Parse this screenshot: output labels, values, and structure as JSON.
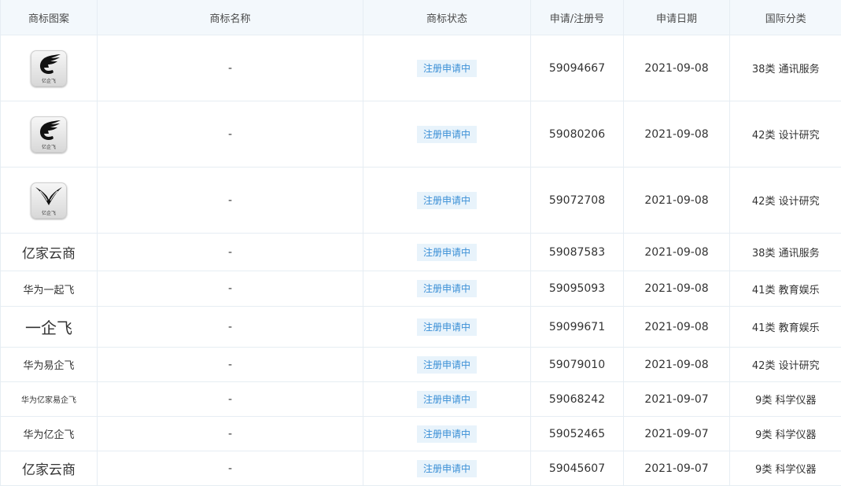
{
  "headers": {
    "image": "商标图案",
    "name": "商标名称",
    "status": "商标状态",
    "reg_no": "申请/注册号",
    "date": "申请日期",
    "class": "国际分类"
  },
  "rows": [
    {
      "mark_type": "image",
      "icon": "wing-g-logo-icon",
      "mark_caption": "亿企飞",
      "name": "-",
      "status": "注册申请中",
      "reg_no": "59094667",
      "date": "2021-09-08",
      "class": "38类 通讯服务"
    },
    {
      "mark_type": "image",
      "icon": "wing-g-logo-icon",
      "mark_caption": "亿企飞",
      "name": "-",
      "status": "注册申请中",
      "reg_no": "59080206",
      "date": "2021-09-08",
      "class": "42类 设计研究"
    },
    {
      "mark_type": "image",
      "icon": "wings-logo-icon",
      "mark_caption": "亿企飞",
      "name": "-",
      "status": "注册申请中",
      "reg_no": "59072708",
      "date": "2021-09-08",
      "class": "42类 设计研究"
    },
    {
      "mark_type": "text",
      "mark_text": "亿家云商",
      "name": "-",
      "status": "注册申请中",
      "reg_no": "59087583",
      "date": "2021-09-08",
      "class": "38类 通讯服务"
    },
    {
      "mark_type": "text",
      "mark_text": "华为一起飞",
      "name": "-",
      "status": "注册申请中",
      "reg_no": "59095093",
      "date": "2021-09-08",
      "class": "41类 教育娱乐"
    },
    {
      "mark_type": "text",
      "mark_text": "一企飞",
      "name": "-",
      "status": "注册申请中",
      "reg_no": "59099671",
      "date": "2021-09-08",
      "class": "41类 教育娱乐"
    },
    {
      "mark_type": "text",
      "mark_text": "华为易企飞",
      "name": "-",
      "status": "注册申请中",
      "reg_no": "59079010",
      "date": "2021-09-08",
      "class": "42类 设计研究"
    },
    {
      "mark_type": "text",
      "mark_text": "华为亿家易企飞",
      "name": "-",
      "status": "注册申请中",
      "reg_no": "59068242",
      "date": "2021-09-07",
      "class": "9类 科学仪器"
    },
    {
      "mark_type": "text",
      "mark_text": "华为亿企飞",
      "name": "-",
      "status": "注册申请中",
      "reg_no": "59052465",
      "date": "2021-09-07",
      "class": "9类 科学仪器"
    },
    {
      "mark_type": "text",
      "mark_text": "亿家云商",
      "name": "-",
      "status": "注册申请中",
      "reg_no": "59045607",
      "date": "2021-09-07",
      "class": "9类 科学仪器"
    }
  ],
  "colors": {
    "header_bg": "#f3f8fc",
    "border": "#e6edf3",
    "badge_bg": "#e8f3fb",
    "badge_text": "#3a8fd6"
  }
}
